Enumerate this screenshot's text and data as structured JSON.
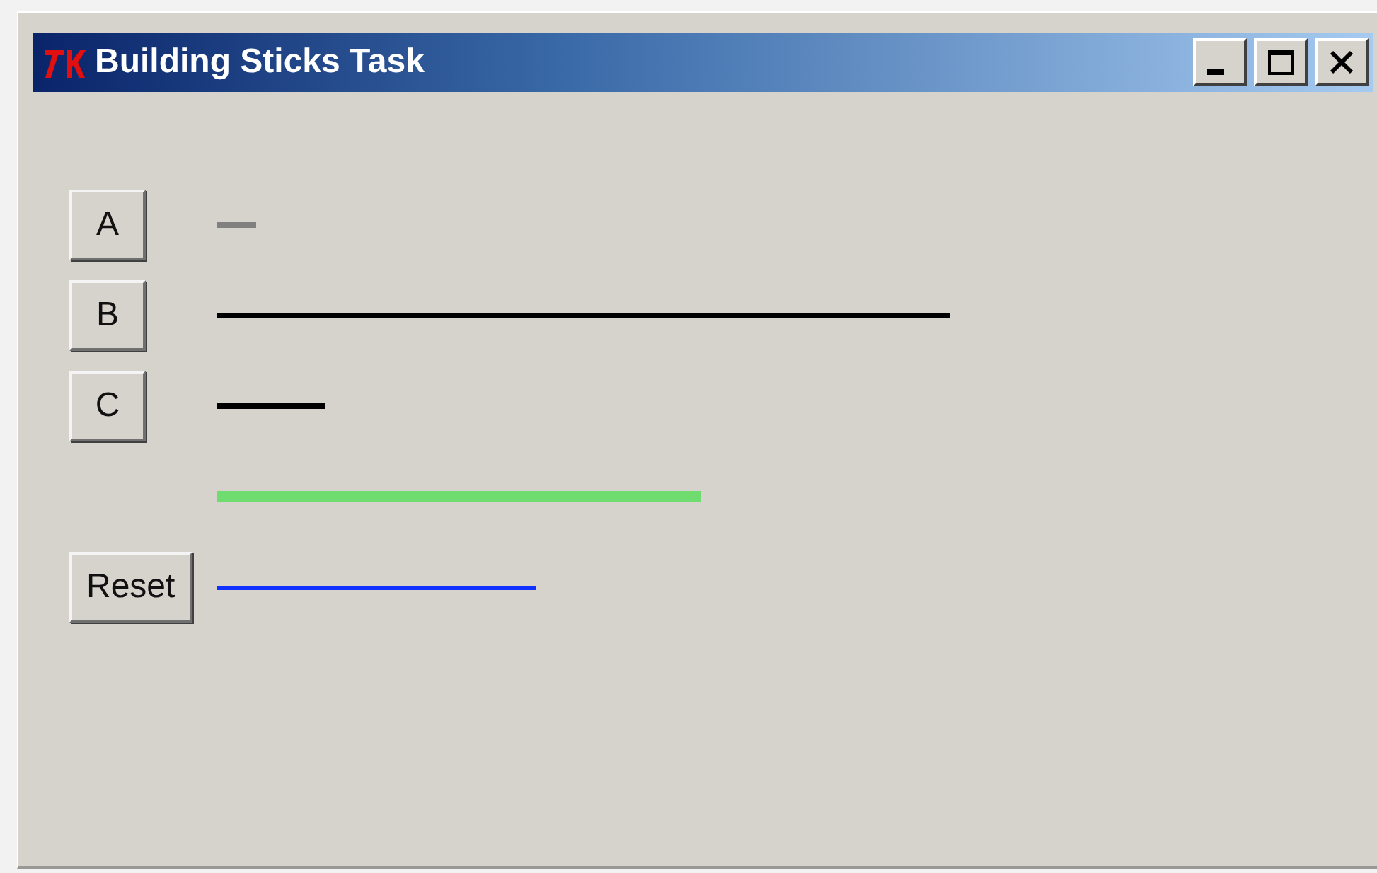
{
  "window": {
    "title": "Building Sticks Task"
  },
  "rows": [
    {
      "kind": "stick",
      "label": "A",
      "color": "#808080"
    },
    {
      "kind": "stick",
      "label": "B",
      "color": "#000000"
    },
    {
      "kind": "stick",
      "label": "C",
      "color": "#000000"
    },
    {
      "kind": "goal",
      "color": "#6edc6e"
    },
    {
      "kind": "reset",
      "label": "Reset",
      "color": "#1030ff"
    }
  ]
}
